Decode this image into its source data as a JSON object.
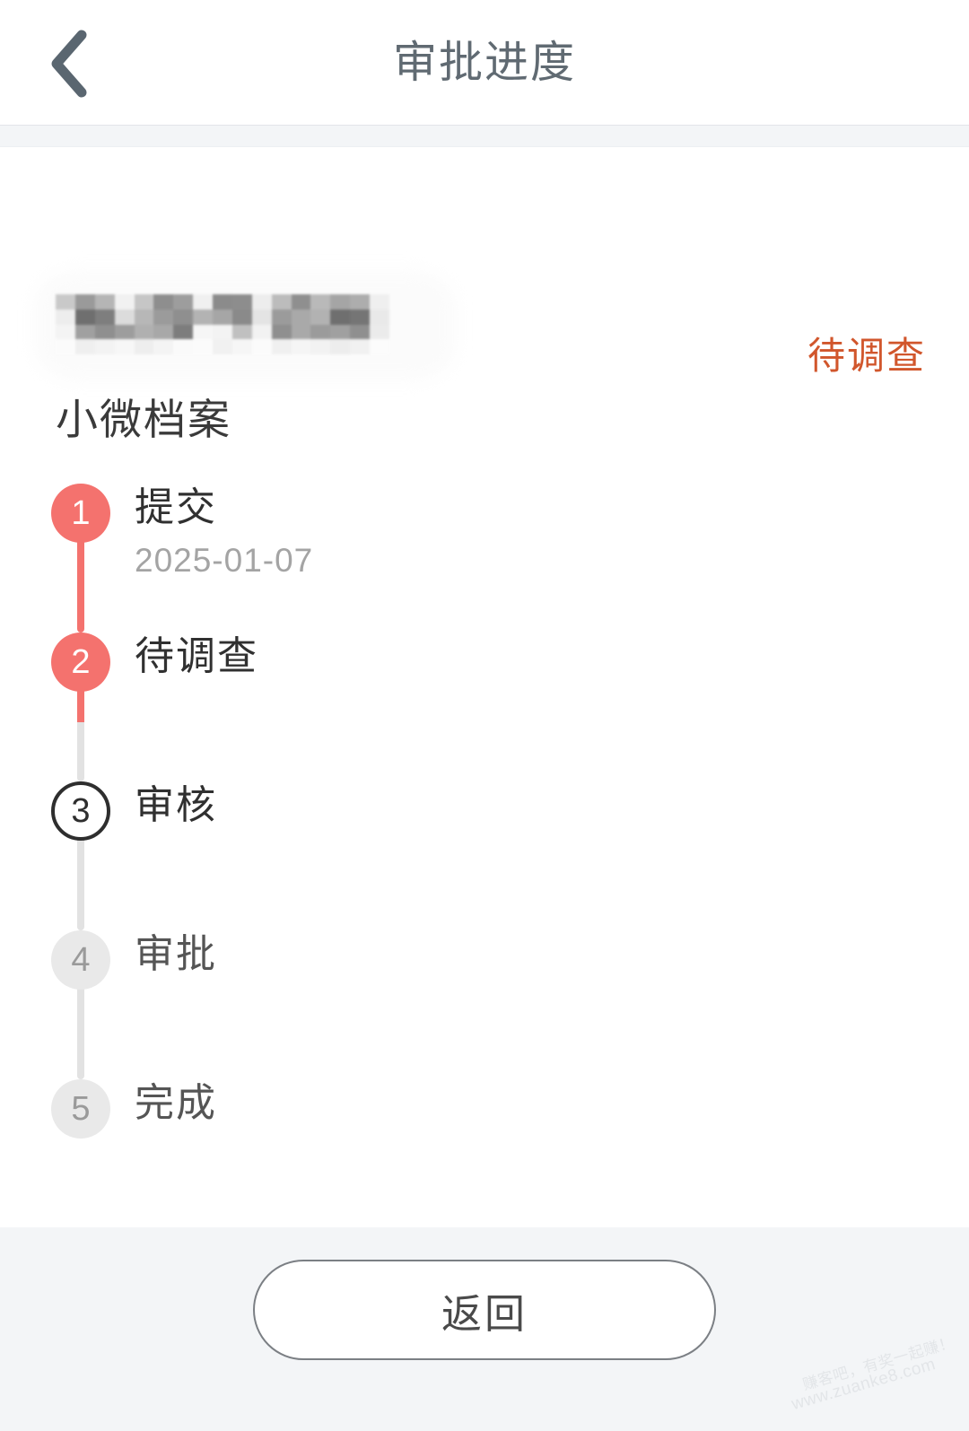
{
  "header": {
    "title": "审批进度",
    "back_icon": "chevron-left-icon"
  },
  "content": {
    "status_badge": "待调查",
    "status_color": "#d1562c",
    "redacted_title": "",
    "doc_subtitle": "小微档案"
  },
  "timeline": {
    "steps": [
      {
        "number": "1",
        "label": "提交",
        "date": "2025-01-07",
        "state": "done"
      },
      {
        "number": "2",
        "label": "待调查",
        "date": "",
        "state": "done"
      },
      {
        "number": "3",
        "label": "审核",
        "date": "",
        "state": "current"
      },
      {
        "number": "4",
        "label": "审批",
        "date": "",
        "state": "pending"
      },
      {
        "number": "5",
        "label": "完成",
        "date": "",
        "state": "pending"
      }
    ],
    "active_color": "#f4726e",
    "pending_color": "#e9e9e9"
  },
  "footer": {
    "back_button": "返回"
  },
  "watermark": {
    "line1": "赚客吧，有奖一起赚！",
    "line2": "www.zuanke8.com"
  }
}
